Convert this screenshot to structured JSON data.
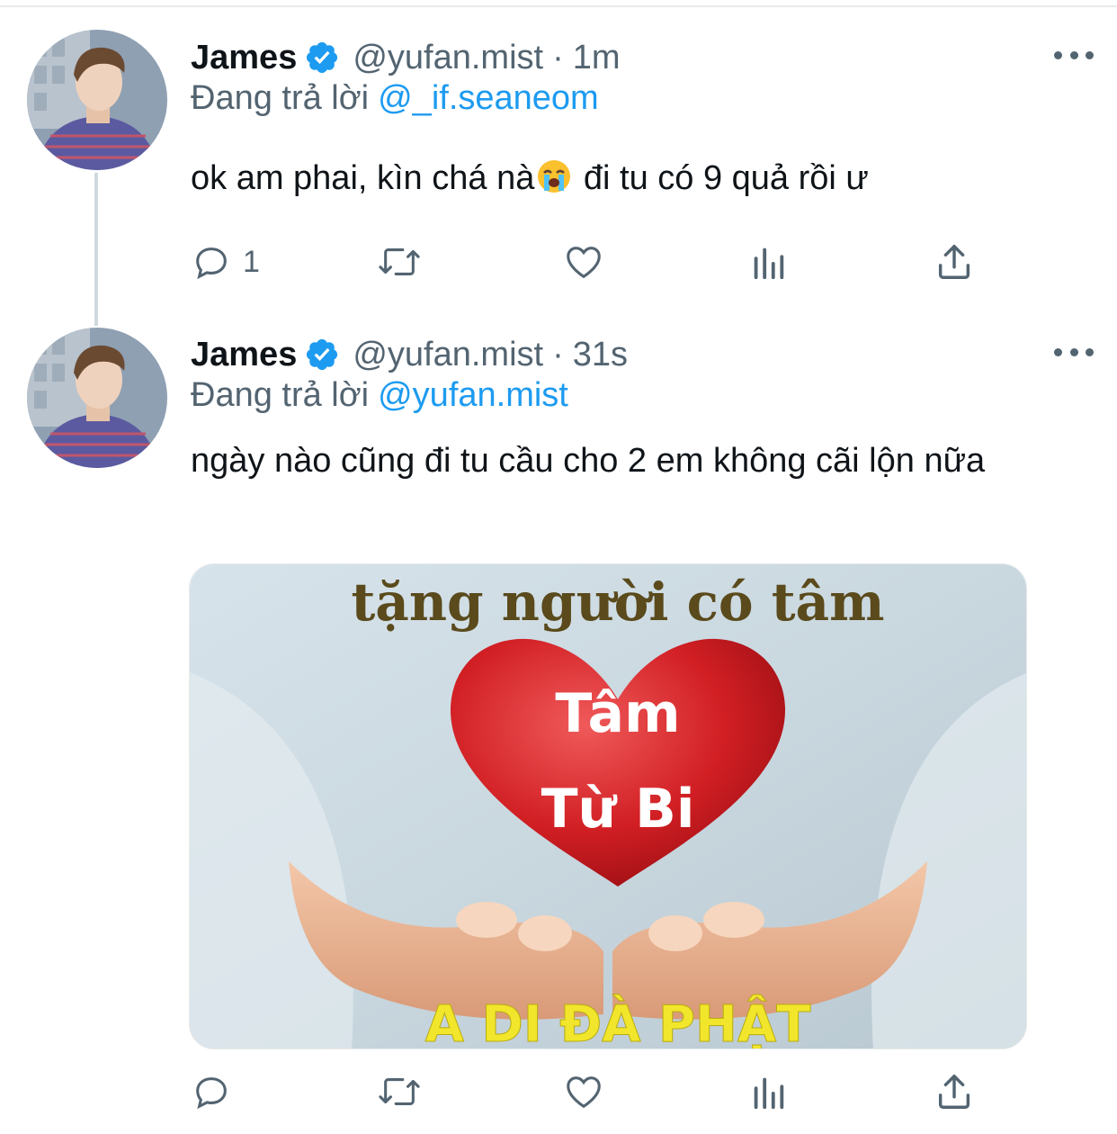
{
  "tweets": [
    {
      "display_name": "James",
      "handle": "@yufan.mist",
      "separator": "·",
      "time": "1m",
      "replying_prefix": "Đang trả lời",
      "replying_to": "@_if.seaneom",
      "text_before_emoji": "ok am phai, kìn chá nà",
      "emoji": "loudly-crying-face",
      "text_after_emoji": " đi tu có 9 quả rồi ư",
      "reply_count": "1",
      "retweet_count": "",
      "like_count": ""
    },
    {
      "display_name": "James",
      "handle": "@yufan.mist",
      "separator": "·",
      "time": "31s",
      "replying_prefix": "Đang trả lời",
      "replying_to": "@yufan.mist",
      "text": "ngày nào cũng đi tu cầu cho 2 em không cãi lộn nữa",
      "media": {
        "top_text": "tặng người có tâm",
        "heart_line1": "Tâm",
        "heart_line2": "Từ Bi",
        "bottom_text": "A DI ĐÀ PHẬT"
      },
      "reply_count": "",
      "retweet_count": "",
      "like_count": ""
    }
  ],
  "colors": {
    "text_primary": "#0f1419",
    "text_secondary": "#536471",
    "accent_blue": "#1d9bf0",
    "thread_line": "#cfd9de"
  },
  "icons": {
    "verified": "verified-badge-icon",
    "more": "more-horizontal-icon",
    "reply": "reply-bubble-icon",
    "retweet": "retweet-icon",
    "like": "heart-icon",
    "views": "views-chart-icon",
    "share": "share-icon"
  }
}
